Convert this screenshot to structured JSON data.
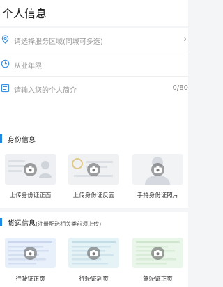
{
  "header": {
    "title": "个人信息"
  },
  "form": {
    "service_area": {
      "placeholder": "请选择服务区域(同城可多选)",
      "icon": "location-pin-icon"
    },
    "years": {
      "placeholder": "从业年限",
      "icon": "clock-icon"
    },
    "intro": {
      "placeholder": "请输入您的个人简介",
      "counter": "0/80",
      "icon": "note-icon"
    }
  },
  "identity": {
    "title": "身份信息",
    "cards": [
      {
        "label": "上传身份证正面"
      },
      {
        "label": "上传身份证反面"
      },
      {
        "label": "手持身份证照片"
      }
    ]
  },
  "freight": {
    "title": "货运信息",
    "note": "(注册配送相关类前须上传)",
    "cards": [
      {
        "label": "行驶证正页"
      },
      {
        "label": "行驶证副页"
      },
      {
        "label": "驾驶证正页"
      }
    ]
  },
  "colors": {
    "accent": "#1e88e5"
  }
}
